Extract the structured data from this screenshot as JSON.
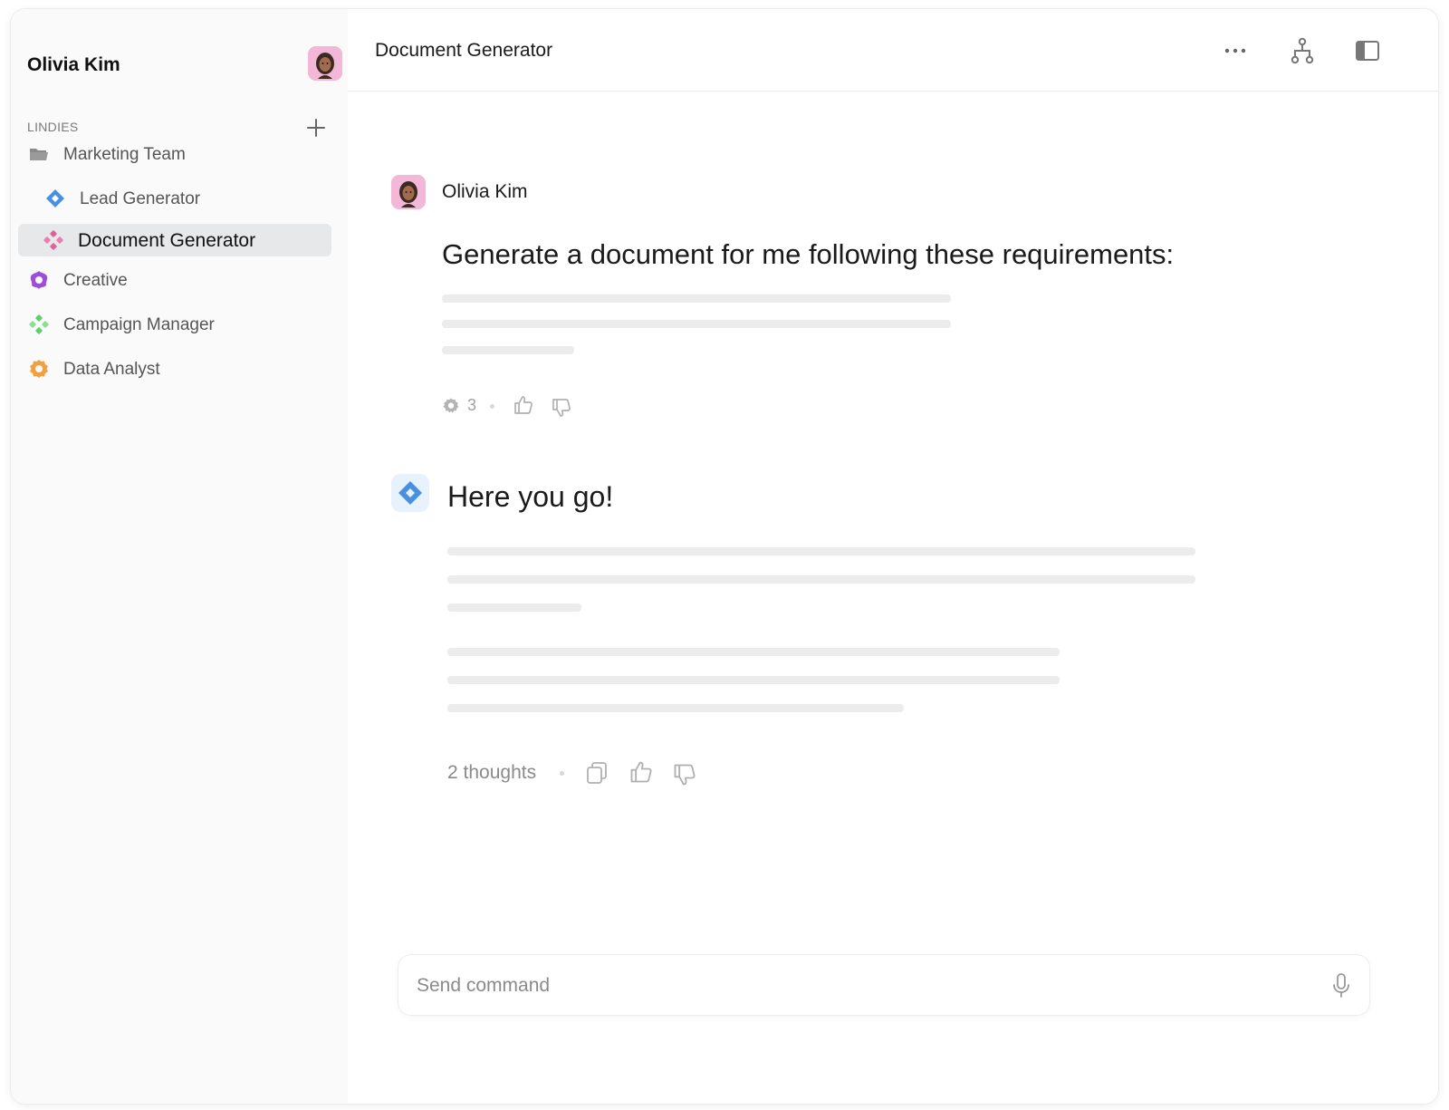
{
  "user": {
    "name": "Olivia Kim"
  },
  "sidebar": {
    "section_label": "LINDIES",
    "items": [
      {
        "label": "Marketing Team",
        "icon": "folder-icon",
        "level": 0,
        "active": false
      },
      {
        "label": "Lead Generator",
        "icon": "diamond-blue-icon",
        "level": 1,
        "active": false
      },
      {
        "label": "Document Generator",
        "icon": "diamond-pink-icon",
        "level": 1,
        "active": true
      },
      {
        "label": "Creative",
        "icon": "flower-purple-icon",
        "level": 0,
        "active": false
      },
      {
        "label": "Campaign Manager",
        "icon": "diamond-green-icon",
        "level": 0,
        "active": false
      },
      {
        "label": "Data Analyst",
        "icon": "ring-orange-icon",
        "level": 0,
        "active": false
      }
    ]
  },
  "header": {
    "title": "Document Generator",
    "icons": [
      "more-icon",
      "workflow-icon",
      "sidebar-toggle-icon"
    ]
  },
  "conversation": {
    "user_message": {
      "sender": "Olivia Kim",
      "text": "Generate a document for me following these requirements:",
      "meta_count": "3"
    },
    "bot_message": {
      "text": "Here you go!",
      "thoughts": "2 thoughts"
    }
  },
  "composer": {
    "placeholder": "Send command"
  },
  "colors": {
    "accent_blue": "#4a90e2",
    "accent_pink": "#e0609a",
    "accent_purple": "#9b4fd9",
    "accent_green": "#5fcf6b",
    "accent_orange": "#f0a041",
    "active_bg": "#e7e8ea"
  }
}
